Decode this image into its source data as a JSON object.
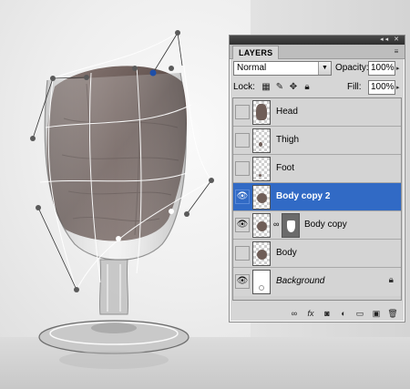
{
  "panel": {
    "tab_label": "LAYERS",
    "titlebar_icons": "◂◂ ✕",
    "menu_icon": "≡",
    "blend_mode": "Normal",
    "opacity_label": "Opacity:",
    "opacity_value": "100%",
    "lock_label": "Lock:",
    "fill_label": "Fill:",
    "fill_value": "100%"
  },
  "layers": [
    {
      "name": "Head",
      "visible": false,
      "selected": false,
      "thumb": "head"
    },
    {
      "name": "Thigh",
      "visible": false,
      "selected": false,
      "thumb": "thigh"
    },
    {
      "name": "Foot",
      "visible": false,
      "selected": false,
      "thumb": "foot"
    },
    {
      "name": "Body copy 2",
      "visible": true,
      "selected": true,
      "thumb": "body"
    },
    {
      "name": "Body copy",
      "visible": true,
      "selected": false,
      "thumb": "body",
      "has_mask": true
    },
    {
      "name": "Body",
      "visible": false,
      "selected": false,
      "thumb": "body"
    },
    {
      "name": "Background",
      "visible": true,
      "selected": false,
      "thumb": "background",
      "locked": true
    }
  ],
  "icons": {
    "eye": "eye-icon",
    "lock_transparent": "checker-lock-icon",
    "lock_image": "brush-lock-icon",
    "lock_position": "move-lock-icon",
    "lock_all": "padlock-icon",
    "footer": [
      "link-icon",
      "fx-icon",
      "mask-icon",
      "adjustment-icon",
      "folder-icon",
      "new-layer-icon",
      "trash-icon"
    ]
  },
  "colors": {
    "selection": "#316ac5",
    "panel_bg": "#d6d6d6"
  }
}
